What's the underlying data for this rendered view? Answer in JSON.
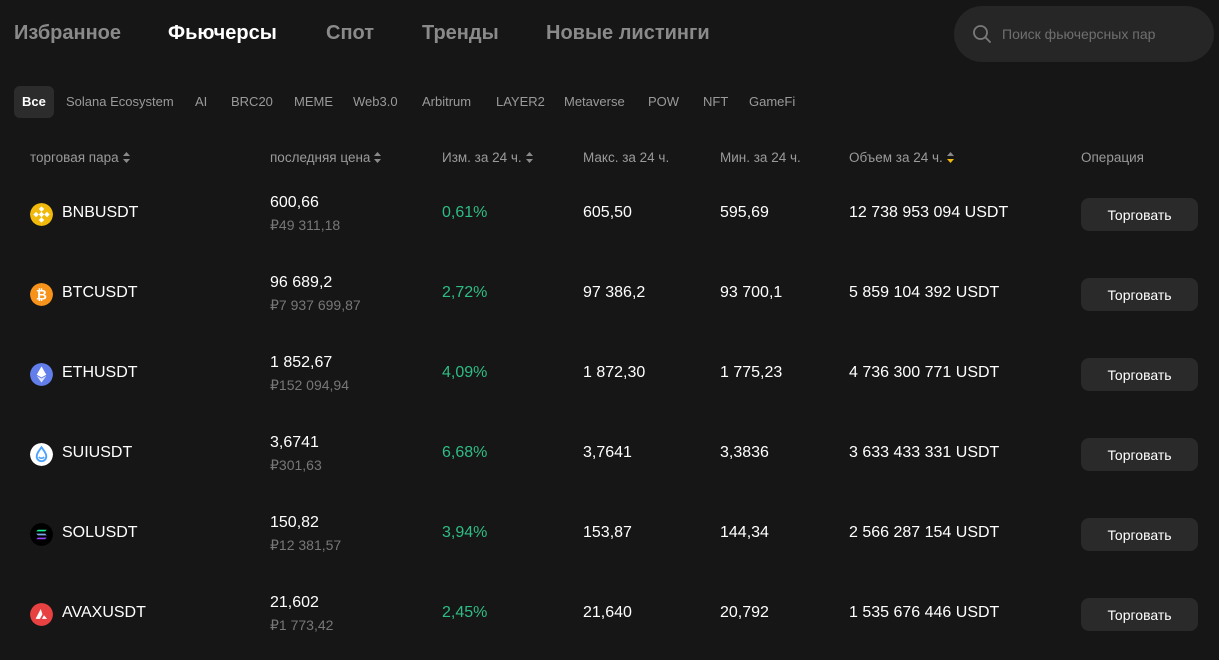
{
  "nav": {
    "tabs": [
      "Избранное",
      "Фьючерсы",
      "Спот",
      "Тренды",
      "Новые листинги"
    ],
    "active_tab": "Фьючерсы"
  },
  "search": {
    "placeholder": "Поиск фьючерсных пар",
    "value": ""
  },
  "categories": [
    "Все",
    "Solana Ecosystem",
    "AI",
    "BRC20",
    "MEME",
    "Web3.0",
    "Arbitrum",
    "LAYER2",
    "Metaverse",
    "POW",
    "NFT",
    "GameFi"
  ],
  "active_category": "Все",
  "table": {
    "headers": {
      "pair": "торговая пара",
      "last_price": "последняя цена",
      "change": "Изм. за 24 ч.",
      "high": "Макс. за 24 ч.",
      "low": "Мин. за 24 ч.",
      "volume": "Объем за 24 ч.",
      "operation": "Операция"
    },
    "rows": [
      {
        "symbol": "BNBUSDT",
        "price": "600,66",
        "fiat": "₽49 311,18",
        "change": "0,61%",
        "high": "605,50",
        "low": "595,69",
        "volume": "12 738 953 094 USDT",
        "action": "Торговать",
        "icon": "bnb-icon"
      },
      {
        "symbol": "BTCUSDT",
        "price": "96 689,2",
        "fiat": "₽7 937 699,87",
        "change": "2,72%",
        "high": "97 386,2",
        "low": "93 700,1",
        "volume": "5 859 104 392 USDT",
        "action": "Торговать",
        "icon": "btc-icon"
      },
      {
        "symbol": "ETHUSDT",
        "price": "1 852,67",
        "fiat": "₽152 094,94",
        "change": "4,09%",
        "high": "1 872,30",
        "low": "1 775,23",
        "volume": "4 736 300 771 USDT",
        "action": "Торговать",
        "icon": "eth-icon"
      },
      {
        "symbol": "SUIUSDT",
        "price": "3,6741",
        "fiat": "₽301,63",
        "change": "6,68%",
        "high": "3,7641",
        "low": "3,3836",
        "volume": "3 633 433 331 USDT",
        "action": "Торговать",
        "icon": "sui-icon"
      },
      {
        "symbol": "SOLUSDT",
        "price": "150,82",
        "fiat": "₽12 381,57",
        "change": "3,94%",
        "high": "153,87",
        "low": "144,34",
        "volume": "2 566 287 154 USDT",
        "action": "Торговать",
        "icon": "sol-icon"
      },
      {
        "symbol": "AVAXUSDT",
        "price": "21,602",
        "fiat": "₽1 773,42",
        "change": "2,45%",
        "high": "21,640",
        "low": "20,792",
        "volume": "1 535 676 446 USDT",
        "action": "Торговать",
        "icon": "avax-icon"
      }
    ]
  },
  "colors": {
    "background": "#161616",
    "positive": "#2ebd85",
    "accent_sort": "#f0b90b",
    "muted_text": "#9a9a9a",
    "button_bg": "#2a2a2a"
  }
}
